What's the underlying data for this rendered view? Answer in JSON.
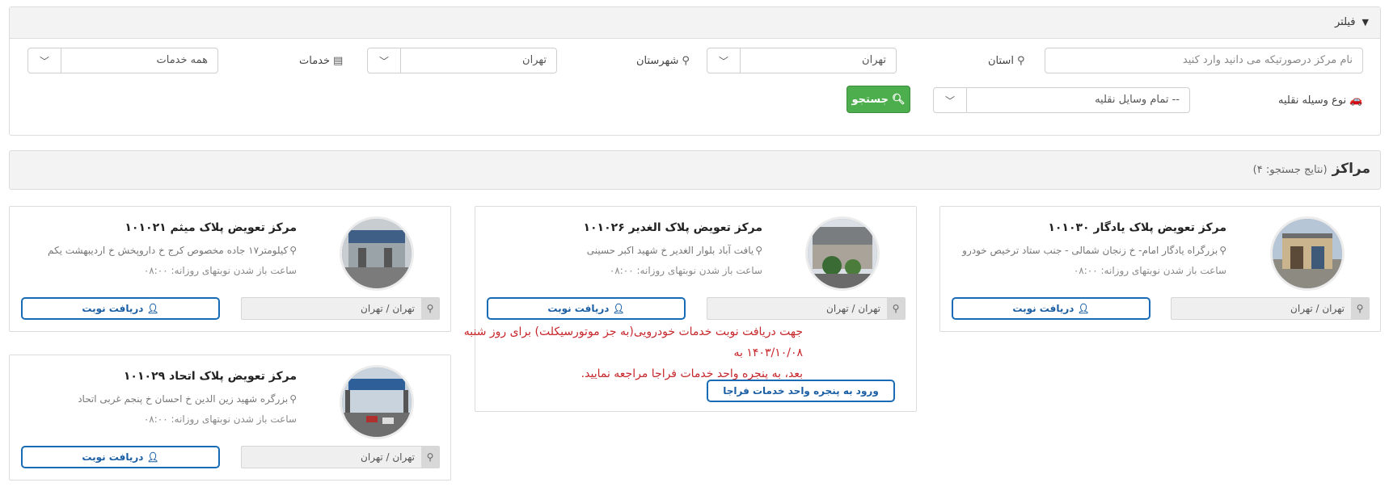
{
  "filter": {
    "title": "فیلتر",
    "center_name_placeholder": "نام مرکز درصورتیکه می دانید وارد کنید",
    "province_label": "استان",
    "province_value": "تهران",
    "city_label": "شهرستان",
    "city_value": "تهران",
    "services_label": "خدمات",
    "services_value": "همه خدمات",
    "vehicle_label": "نوع وسیله نقلیه",
    "vehicle_value": "-- تمام وسایل نقلیه",
    "search_button": "جستجو"
  },
  "results": {
    "title": "مراکز",
    "subtitle": "(نتایج جستجو: ۴)"
  },
  "cards": [
    {
      "title": "مرکز تعویض پلاک یادگار ۱۰۱۰۳۰",
      "address": "بزرگراه یادگار امام- خ زنجان شمالی - جنب ستاد ترخیص خودرو",
      "hours": "ساعت باز شدن نوبتهای روزانه: ۰۸:۰۰",
      "location": "تهران / تهران",
      "button": "دریافت نوبت"
    },
    {
      "title": "مرکز تعویض پلاک الغدیر ۱۰۱۰۲۶",
      "address": "یافت آباد بلوار الغدیر خ شهید اکبر حسینی",
      "hours": "ساعت باز شدن نوبتهای روزانه: ۰۸:۰۰",
      "location": "تهران / تهران",
      "notice_line1": "جهت دریافت نوبت خدمات خودرویی(به جز موتورسیکلت) برای روز شنبه ۱۴۰۳/۱۰/۰۸ به",
      "notice_line2": "بعد، به پنجره واحد خدمات فراجا مراجعه نمایید.",
      "portal_button": "ورود به پنجره واحد خدمات فراجا"
    },
    {
      "title": "مرکز تعویض پلاک میثم ۱۰۱۰۲۱",
      "address": "کیلومتر۱۷ جاده مخصوص کرج خ داروپخش خ اردیبهشت یکم",
      "hours": "ساعت باز شدن نوبتهای روزانه: ۰۸:۰۰",
      "location": "تهران / تهران",
      "button": "دریافت نوبت"
    },
    {
      "title": "مرکز تعویض پلاک اتحاد ۱۰۱۰۲۹",
      "address": "بزرگره شهید زین الدین خ احسان خ پنجم غربی اتحاد",
      "hours": "ساعت باز شدن نوبتهای روزانه: ۰۸:۰۰",
      "location": "تهران / تهران",
      "button": "دریافت نوبت"
    }
  ],
  "colors": {
    "accent_blue": "#1a6bb5",
    "search_green": "#4cae4c",
    "notice_red": "#c7262b"
  }
}
